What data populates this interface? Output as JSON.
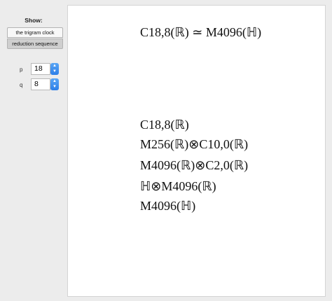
{
  "controls": {
    "show_label": "Show:",
    "options": [
      "the trigram clock",
      "reduction sequence"
    ],
    "selected": "reduction sequence",
    "p": {
      "label": "p",
      "value": "18"
    },
    "q": {
      "label": "q",
      "value": "8"
    }
  },
  "output": {
    "heading": "C18,8(ℝ) ≃ M4096(ℍ)",
    "sequence": [
      "C18,8(ℝ)",
      "M256(ℝ)⊗C10,0(ℝ)",
      "M4096(ℝ)⊗C2,0(ℝ)",
      "ℍ⊗M4096(ℝ)",
      "M4096(ℍ)"
    ]
  },
  "colors": {
    "stepper": "#2d7fe8",
    "selected_segment": "#cfcfcf"
  }
}
